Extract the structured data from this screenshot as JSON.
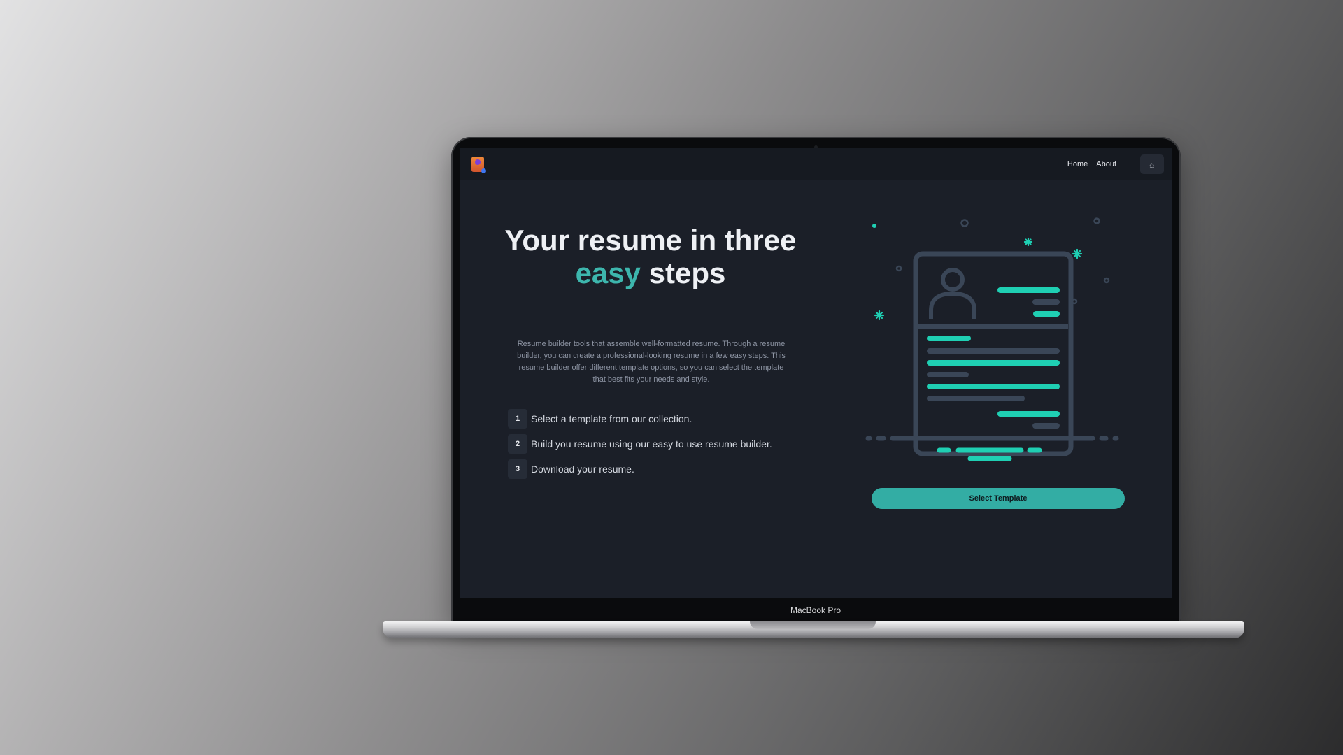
{
  "device": {
    "label": "MacBook Pro"
  },
  "navbar": {
    "logo_icon": "resume-app-logo",
    "links": [
      {
        "label": "Home"
      },
      {
        "label": "About"
      }
    ],
    "theme_toggle_icon": "sun-icon",
    "theme_toggle_glyph": "☼"
  },
  "hero": {
    "title_line1": "Your resume in three",
    "title_accent": "easy",
    "title_rest": " steps",
    "description": "Resume builder tools that assemble well-formatted resume. Through a resume builder, you can create a professional-looking resume in a few easy steps. This resume builder offer different template options, so you can select the template that best fits your needs and style.",
    "steps": [
      {
        "number": "1",
        "text": "Select a template from our collection."
      },
      {
        "number": "2",
        "text": "Build you resume using our easy to use resume builder."
      },
      {
        "number": "3",
        "text": "Download your resume."
      }
    ],
    "cta_label": "Select Template"
  },
  "colors": {
    "accent": "#3db6ad",
    "screen_background": "#1b1f28",
    "navbar_background": "#161a21",
    "illustration_stroke": "#3a4657",
    "illustration_highlight": "#1fcfb3"
  }
}
